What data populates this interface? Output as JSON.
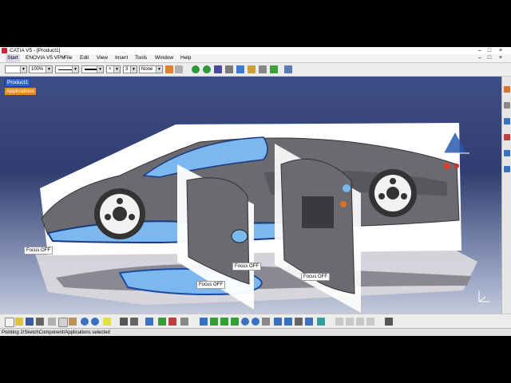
{
  "window": {
    "title": "CATIA V5 - [Product1]",
    "buttons": [
      "–",
      "□",
      "×"
    ]
  },
  "menubar": {
    "items": [
      "Start",
      "ENOVIA V5 VPM",
      "File",
      "Edit",
      "View",
      "Insert",
      "Tools",
      "Window",
      "Help"
    ],
    "doc_buttons": [
      "–",
      "□",
      "×"
    ]
  },
  "toolbar": {
    "layer_value": "",
    "zoom_value": "100%",
    "line_weight_value": "3",
    "layer_none_value": "None"
  },
  "tree": {
    "root": "Product1",
    "child": "Applications"
  },
  "viewport": {
    "labels": [
      "Focus OFF",
      "Focus OFF",
      "Focus OFF",
      "Focus OFF"
    ]
  },
  "status": {
    "message": "Pointing 2/SketchComponent/Applications selected"
  },
  "colors": {
    "background_top": "#3f4e86",
    "background_bottom": "#c4cadb",
    "selection": "#3264c8",
    "applications_highlight": "#f08a1c",
    "car_body": "#6b6a70",
    "car_accent": "#7cb8f0"
  }
}
